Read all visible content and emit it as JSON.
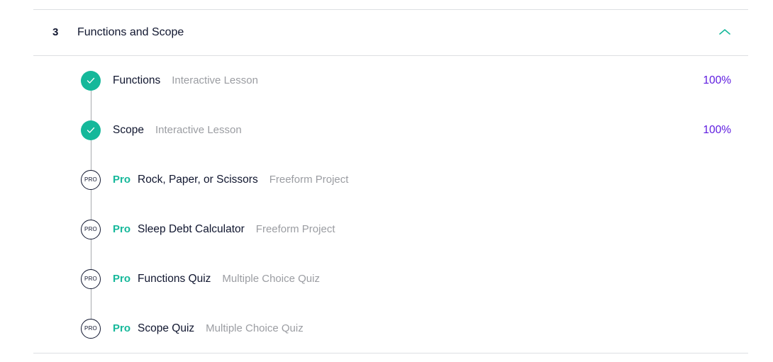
{
  "module": {
    "number": "3",
    "title": "Functions and Scope",
    "expanded_icon": "chevron-up-icon",
    "accent_color": "#15b89a"
  },
  "lessons": [
    {
      "status": "completed",
      "pro_label": "",
      "name": "Functions",
      "type": "Interactive Lesson",
      "progress": "100%"
    },
    {
      "status": "completed",
      "pro_label": "",
      "name": "Scope",
      "type": "Interactive Lesson",
      "progress": "100%"
    },
    {
      "status": "pro",
      "marker_label": "PRO",
      "pro_label": "Pro",
      "name": "Rock, Paper, or Scissors",
      "type": "Freeform Project",
      "progress": ""
    },
    {
      "status": "pro",
      "marker_label": "PRO",
      "pro_label": "Pro",
      "name": "Sleep Debt Calculator",
      "type": "Freeform Project",
      "progress": ""
    },
    {
      "status": "pro",
      "marker_label": "PRO",
      "pro_label": "Pro",
      "name": "Functions Quiz",
      "type": "Multiple Choice Quiz",
      "progress": ""
    },
    {
      "status": "pro",
      "marker_label": "PRO",
      "pro_label": "Pro",
      "name": "Scope Quiz",
      "type": "Multiple Choice Quiz",
      "progress": ""
    }
  ],
  "colors": {
    "completed": "#15b89a",
    "pro": "#15b89a",
    "progress": "#5e1be0",
    "text": "#10162f",
    "muted": "#9b9da2"
  }
}
